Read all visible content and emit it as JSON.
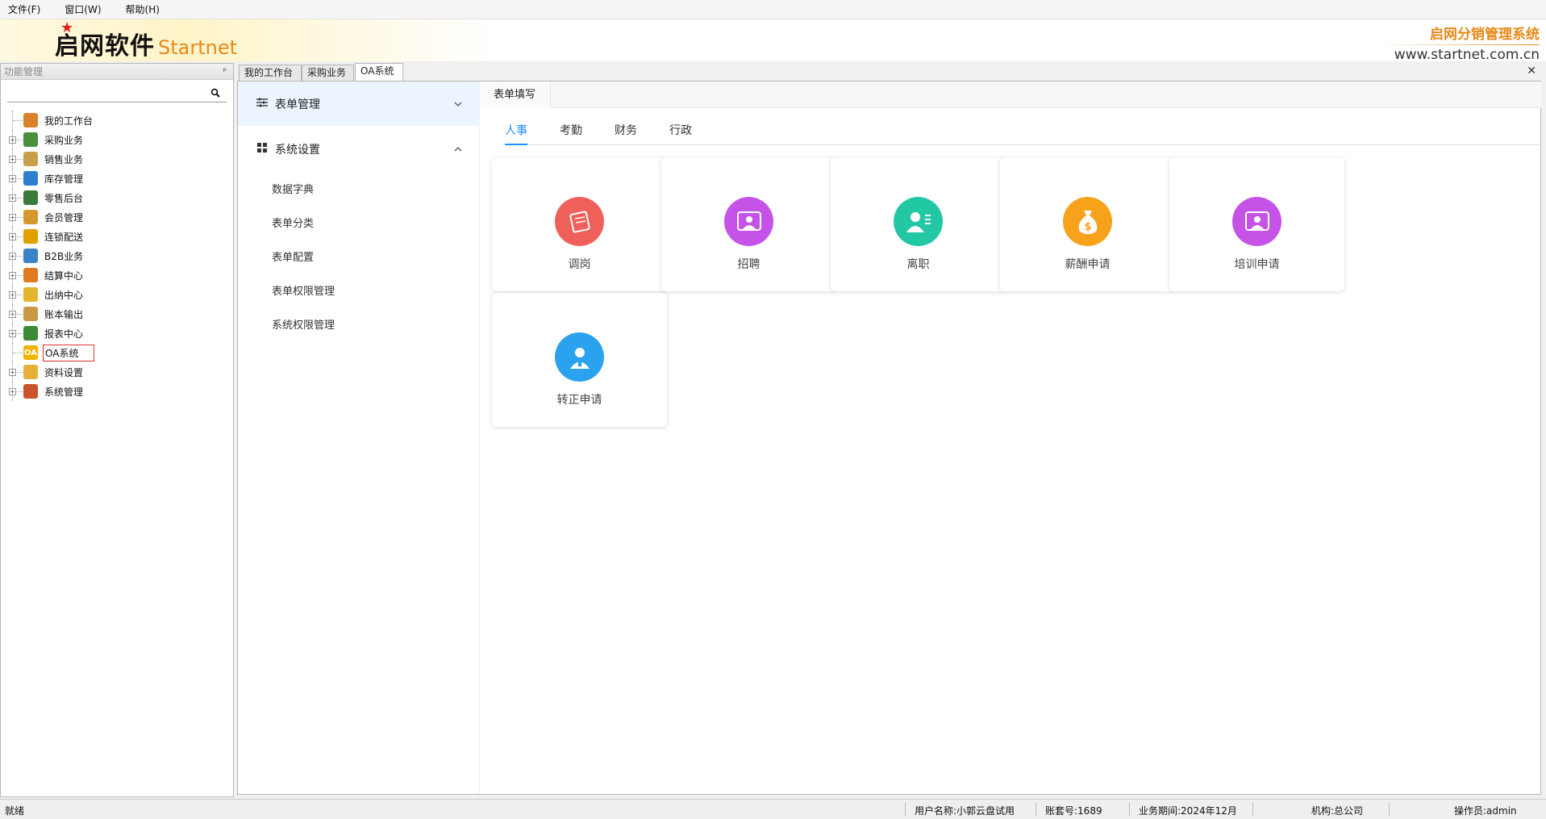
{
  "menubar": {
    "items": [
      {
        "label": "文件(F)"
      },
      {
        "label": "窗口(W)"
      },
      {
        "label": "帮助(H)"
      }
    ]
  },
  "banner": {
    "logo_cn": "启网软件",
    "logo_en": "Startnet",
    "system_name": "启网分销管理系统",
    "website": "www.startnet.com.cn"
  },
  "left_panel": {
    "title": "功能管理",
    "pin_glyph": "ᵖ",
    "search_placeholder": "",
    "tree": [
      {
        "label": "我的工作台",
        "icon": "user-icon",
        "color": "#d9822b",
        "expandable": false
      },
      {
        "label": "采购业务",
        "icon": "purchase-icon",
        "color": "#4a8f3c",
        "expandable": true
      },
      {
        "label": "销售业务",
        "icon": "clipboard-icon",
        "color": "#c8a04a",
        "expandable": true
      },
      {
        "label": "库存管理",
        "icon": "inventory-icon",
        "color": "#2f7fd1",
        "expandable": true
      },
      {
        "label": "零售后台",
        "icon": "cart-icon",
        "color": "#3b7a3b",
        "expandable": true
      },
      {
        "label": "会员管理",
        "icon": "member-icon",
        "color": "#d4992e",
        "expandable": true
      },
      {
        "label": "连锁配送",
        "icon": "truck-icon",
        "color": "#e0a100",
        "expandable": true
      },
      {
        "label": "B2B业务",
        "icon": "b2b-icon",
        "color": "#3a83c9",
        "expandable": true
      },
      {
        "label": "结算中心",
        "icon": "settlement-icon",
        "color": "#e07a1f",
        "expandable": true
      },
      {
        "label": "出纳中心",
        "icon": "yen-icon",
        "color": "#e2b62a",
        "expandable": true
      },
      {
        "label": "账本输出",
        "icon": "ledger-icon",
        "color": "#c89a45",
        "expandable": true
      },
      {
        "label": "报表中心",
        "icon": "report-icon",
        "color": "#3a8a3a",
        "expandable": true
      },
      {
        "label": "OA系统",
        "icon": "oa-icon",
        "color": "#f0b400",
        "expandable": false,
        "selected": true
      },
      {
        "label": "资料设置",
        "icon": "folder-icon",
        "color": "#e5b13a",
        "expandable": true
      },
      {
        "label": "系统管理",
        "icon": "admin-icon",
        "color": "#c9532b",
        "expandable": true
      }
    ]
  },
  "tabs": [
    {
      "label": "我的工作台"
    },
    {
      "label": "采购业务"
    },
    {
      "label": "OA系统",
      "active": true
    }
  ],
  "close_glyph": "✕",
  "side_menu": {
    "form_management": "表单管理",
    "system_settings": "系统设置",
    "items": [
      "数据字典",
      "表单分类",
      "表单配置",
      "表单权限管理",
      "系统权限管理"
    ]
  },
  "panel": {
    "tab_label": "表单填写",
    "categories": [
      {
        "label": "人事",
        "active": true
      },
      {
        "label": "考勤"
      },
      {
        "label": "财务"
      },
      {
        "label": "行政"
      }
    ],
    "cards": [
      {
        "label": "调岗",
        "icon": "transfer-icon",
        "color": "#f0605a"
      },
      {
        "label": "招聘",
        "icon": "recruit-icon",
        "color": "#c653e8"
      },
      {
        "label": "离职",
        "icon": "resign-icon",
        "color": "#22c7a4"
      },
      {
        "label": "薪酬申请",
        "icon": "money-bag-icon",
        "color": "#f7a21b"
      },
      {
        "label": "培训申请",
        "icon": "training-icon",
        "color": "#c653e8"
      },
      {
        "label": "转正申请",
        "icon": "regular-icon",
        "color": "#2aa2ee"
      }
    ]
  },
  "status": {
    "ready": "就绪",
    "user": "用户名称:小郭云盘试用",
    "account": "账套号:1689",
    "period": "业务期间:2024年12月",
    "org": "机构:总公司",
    "operator": "操作员:admin"
  }
}
